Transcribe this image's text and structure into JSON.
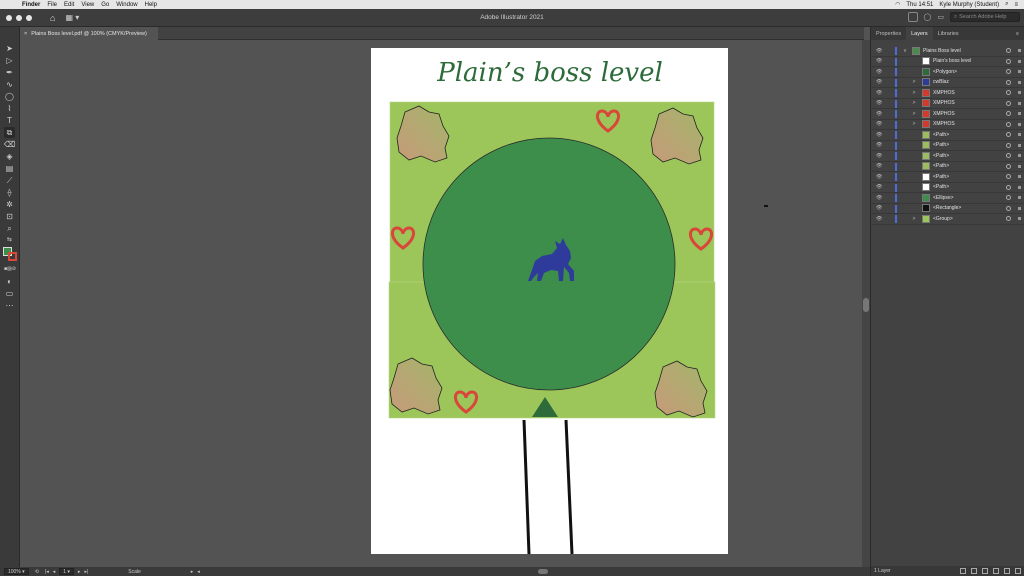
{
  "menubar": {
    "app": "Finder",
    "items": [
      "File",
      "Edit",
      "View",
      "Go",
      "Window",
      "Help"
    ],
    "clock": "Thu 14:51",
    "user": "Kyle Murphy (Student)"
  },
  "appbar": {
    "title": "Adobe Illustrator 2021",
    "search_placeholder": "Search Adobe Help"
  },
  "document": {
    "tab_label": "Plains Boss level.pdf @ 100% (CMYK/Preview)",
    "close_glyph": "×"
  },
  "artwork": {
    "heading": "Plain’s boss level"
  },
  "status": {
    "zoom": "100%",
    "artboard": "1",
    "tool": "Scale"
  },
  "panel": {
    "tabs": [
      "Properties",
      "Layers",
      "Libraries"
    ],
    "active_tab": "Layers",
    "footer": "1 Layer",
    "layers": [
      {
        "name": "Plains Boss level",
        "expand": "v",
        "thumb": "#4a8a4a",
        "top": true
      },
      {
        "name": "Plain’s boss level",
        "expand": "",
        "thumb": "#ffffff"
      },
      {
        "name": "<Polygon>",
        "expand": "",
        "thumb": "#2e6b3a"
      },
      {
        "name": "cwBlaz",
        "expand": ">",
        "thumb": "#2f3b9a"
      },
      {
        "name": "XMPHOS",
        "expand": ">",
        "thumb": "#d33a2c"
      },
      {
        "name": "XMPHOS",
        "expand": ">",
        "thumb": "#d33a2c"
      },
      {
        "name": "XMPHOS",
        "expand": ">",
        "thumb": "#d33a2c"
      },
      {
        "name": "XMPHOS",
        "expand": ">",
        "thumb": "#d33a2c"
      },
      {
        "name": "<Path>",
        "expand": "",
        "thumb": "#9bbd60"
      },
      {
        "name": "<Path>",
        "expand": "",
        "thumb": "#9bbd60"
      },
      {
        "name": "<Path>",
        "expand": "",
        "thumb": "#9bbd60"
      },
      {
        "name": "<Path>",
        "expand": "",
        "thumb": "#9bbd60"
      },
      {
        "name": "<Path>",
        "expand": "",
        "thumb": "#ffffff"
      },
      {
        "name": "<Path>",
        "expand": "",
        "thumb": "#ffffff"
      },
      {
        "name": "<Ellipse>",
        "expand": "",
        "thumb": "#3d8e4b"
      },
      {
        "name": "<Rectangle>",
        "expand": "",
        "thumb": "#111111"
      },
      {
        "name": "<Group>",
        "expand": ">",
        "thumb": "#9dc65a"
      }
    ]
  },
  "colors": {
    "grass": "#9dc65a",
    "arena": "#3d8e4b",
    "wolf": "#2f3b9a",
    "heart": "#d9463a",
    "heading": "#2e6b3a",
    "bush_top": "#a3b56a",
    "bush_bottom": "#c79a7a"
  }
}
